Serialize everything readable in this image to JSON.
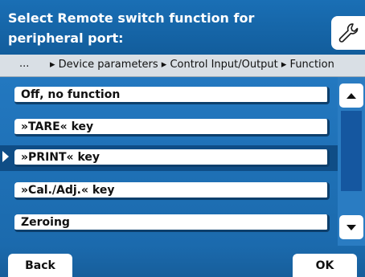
{
  "header": {
    "title": "Select Remote switch function for peripheral port:",
    "icon": "wrench-icon"
  },
  "breadcrumb": {
    "ellipsis": "...",
    "path": "▸ Device parameters ▸ Control Input/Output ▸ Function"
  },
  "list": {
    "items": [
      {
        "label": "Off, no function"
      },
      {
        "label": "»TARE« key"
      },
      {
        "label": "»PRINT« key"
      },
      {
        "label": "»Cal./Adj.« key"
      },
      {
        "label": "Zeroing"
      }
    ],
    "selected_label": "»PRINT« key"
  },
  "scrollbar": {
    "up_icon": "arrow-up-icon",
    "down_icon": "arrow-down-icon"
  },
  "footer": {
    "back_label": "Back",
    "ok_label": "OK"
  },
  "colors": {
    "header_blue": "#1a6fb5",
    "list_blue": "#1b6aad",
    "selected_band": "#0f4d86"
  }
}
